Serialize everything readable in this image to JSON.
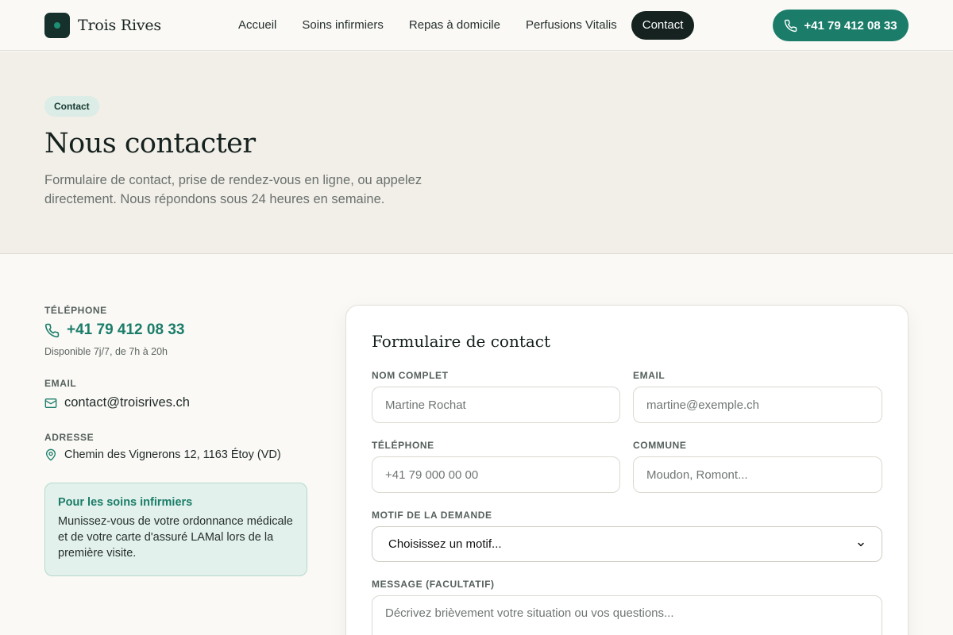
{
  "brand": {
    "name": "Trois Rives"
  },
  "nav": {
    "items": [
      {
        "label": "Accueil"
      },
      {
        "label": "Soins infirmiers"
      },
      {
        "label": "Repas à domicile"
      },
      {
        "label": "Perfusions Vitalis"
      },
      {
        "label": "Contact",
        "active": true
      }
    ],
    "phone_button": "+41 79 412 08 33"
  },
  "hero": {
    "badge": "Contact",
    "title": "Nous contacter",
    "subtitle": "Formulaire de contact, prise de rendez-vous en ligne, ou appelez directement. Nous répondons sous 24 heures en semaine."
  },
  "info": {
    "phone_label": "TÉLÉPHONE",
    "phone": "+41 79 412 08 33",
    "phone_note": "Disponible 7j/7, de 7h à 20h",
    "email_label": "EMAIL",
    "email": "contact@troisrives.ch",
    "address_label": "ADRESSE",
    "address": "Chemin des Vignerons 12, 1163 Étoy (VD)",
    "tip_title": "Pour les soins infirmiers",
    "tip_text": "Munissez-vous de votre ordonnance médicale et de votre carte d'assuré LAMal lors de la première visite."
  },
  "form": {
    "title": "Formulaire de contact",
    "name_label": "NOM COMPLET",
    "name_placeholder": "Martine Rochat",
    "email_label": "EMAIL",
    "email_placeholder": "martine@exemple.ch",
    "phone_label": "TÉLÉPHONE",
    "phone_placeholder": "+41 79 000 00 00",
    "commune_label": "COMMUNE",
    "commune_placeholder": "Moudon, Romont...",
    "motif_label": "MOTIF DE LA DEMANDE",
    "motif_selected": "Choisissez un motif...",
    "message_label": "MESSAGE (FACULTATIF)",
    "message_placeholder": "Décrivez brièvement votre situation ou vos questions..."
  },
  "colors": {
    "accent": "#1b7d69",
    "dark": "#15221f",
    "hero_bg": "#f2efe8",
    "tip_bg": "#e2f1ec"
  }
}
